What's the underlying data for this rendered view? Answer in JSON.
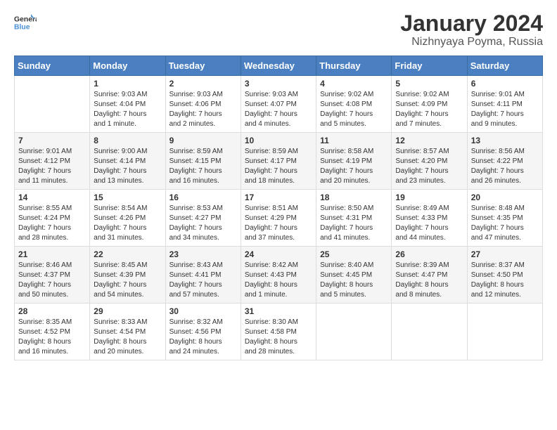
{
  "logo": {
    "line1": "General",
    "line2": "Blue"
  },
  "title": "January 2024",
  "subtitle": "Nizhnyaya Poyma, Russia",
  "days_of_week": [
    "Sunday",
    "Monday",
    "Tuesday",
    "Wednesday",
    "Thursday",
    "Friday",
    "Saturday"
  ],
  "weeks": [
    [
      {
        "day": "",
        "info": ""
      },
      {
        "day": "1",
        "info": "Sunrise: 9:03 AM\nSunset: 4:04 PM\nDaylight: 7 hours\nand 1 minute."
      },
      {
        "day": "2",
        "info": "Sunrise: 9:03 AM\nSunset: 4:06 PM\nDaylight: 7 hours\nand 2 minutes."
      },
      {
        "day": "3",
        "info": "Sunrise: 9:03 AM\nSunset: 4:07 PM\nDaylight: 7 hours\nand 4 minutes."
      },
      {
        "day": "4",
        "info": "Sunrise: 9:02 AM\nSunset: 4:08 PM\nDaylight: 7 hours\nand 5 minutes."
      },
      {
        "day": "5",
        "info": "Sunrise: 9:02 AM\nSunset: 4:09 PM\nDaylight: 7 hours\nand 7 minutes."
      },
      {
        "day": "6",
        "info": "Sunrise: 9:01 AM\nSunset: 4:11 PM\nDaylight: 7 hours\nand 9 minutes."
      }
    ],
    [
      {
        "day": "7",
        "info": "Sunrise: 9:01 AM\nSunset: 4:12 PM\nDaylight: 7 hours\nand 11 minutes."
      },
      {
        "day": "8",
        "info": "Sunrise: 9:00 AM\nSunset: 4:14 PM\nDaylight: 7 hours\nand 13 minutes."
      },
      {
        "day": "9",
        "info": "Sunrise: 8:59 AM\nSunset: 4:15 PM\nDaylight: 7 hours\nand 16 minutes."
      },
      {
        "day": "10",
        "info": "Sunrise: 8:59 AM\nSunset: 4:17 PM\nDaylight: 7 hours\nand 18 minutes."
      },
      {
        "day": "11",
        "info": "Sunrise: 8:58 AM\nSunset: 4:19 PM\nDaylight: 7 hours\nand 20 minutes."
      },
      {
        "day": "12",
        "info": "Sunrise: 8:57 AM\nSunset: 4:20 PM\nDaylight: 7 hours\nand 23 minutes."
      },
      {
        "day": "13",
        "info": "Sunrise: 8:56 AM\nSunset: 4:22 PM\nDaylight: 7 hours\nand 26 minutes."
      }
    ],
    [
      {
        "day": "14",
        "info": "Sunrise: 8:55 AM\nSunset: 4:24 PM\nDaylight: 7 hours\nand 28 minutes."
      },
      {
        "day": "15",
        "info": "Sunrise: 8:54 AM\nSunset: 4:26 PM\nDaylight: 7 hours\nand 31 minutes."
      },
      {
        "day": "16",
        "info": "Sunrise: 8:53 AM\nSunset: 4:27 PM\nDaylight: 7 hours\nand 34 minutes."
      },
      {
        "day": "17",
        "info": "Sunrise: 8:51 AM\nSunset: 4:29 PM\nDaylight: 7 hours\nand 37 minutes."
      },
      {
        "day": "18",
        "info": "Sunrise: 8:50 AM\nSunset: 4:31 PM\nDaylight: 7 hours\nand 41 minutes."
      },
      {
        "day": "19",
        "info": "Sunrise: 8:49 AM\nSunset: 4:33 PM\nDaylight: 7 hours\nand 44 minutes."
      },
      {
        "day": "20",
        "info": "Sunrise: 8:48 AM\nSunset: 4:35 PM\nDaylight: 7 hours\nand 47 minutes."
      }
    ],
    [
      {
        "day": "21",
        "info": "Sunrise: 8:46 AM\nSunset: 4:37 PM\nDaylight: 7 hours\nand 50 minutes."
      },
      {
        "day": "22",
        "info": "Sunrise: 8:45 AM\nSunset: 4:39 PM\nDaylight: 7 hours\nand 54 minutes."
      },
      {
        "day": "23",
        "info": "Sunrise: 8:43 AM\nSunset: 4:41 PM\nDaylight: 7 hours\nand 57 minutes."
      },
      {
        "day": "24",
        "info": "Sunrise: 8:42 AM\nSunset: 4:43 PM\nDaylight: 8 hours\nand 1 minute."
      },
      {
        "day": "25",
        "info": "Sunrise: 8:40 AM\nSunset: 4:45 PM\nDaylight: 8 hours\nand 5 minutes."
      },
      {
        "day": "26",
        "info": "Sunrise: 8:39 AM\nSunset: 4:47 PM\nDaylight: 8 hours\nand 8 minutes."
      },
      {
        "day": "27",
        "info": "Sunrise: 8:37 AM\nSunset: 4:50 PM\nDaylight: 8 hours\nand 12 minutes."
      }
    ],
    [
      {
        "day": "28",
        "info": "Sunrise: 8:35 AM\nSunset: 4:52 PM\nDaylight: 8 hours\nand 16 minutes."
      },
      {
        "day": "29",
        "info": "Sunrise: 8:33 AM\nSunset: 4:54 PM\nDaylight: 8 hours\nand 20 minutes."
      },
      {
        "day": "30",
        "info": "Sunrise: 8:32 AM\nSunset: 4:56 PM\nDaylight: 8 hours\nand 24 minutes."
      },
      {
        "day": "31",
        "info": "Sunrise: 8:30 AM\nSunset: 4:58 PM\nDaylight: 8 hours\nand 28 minutes."
      },
      {
        "day": "",
        "info": ""
      },
      {
        "day": "",
        "info": ""
      },
      {
        "day": "",
        "info": ""
      }
    ]
  ]
}
